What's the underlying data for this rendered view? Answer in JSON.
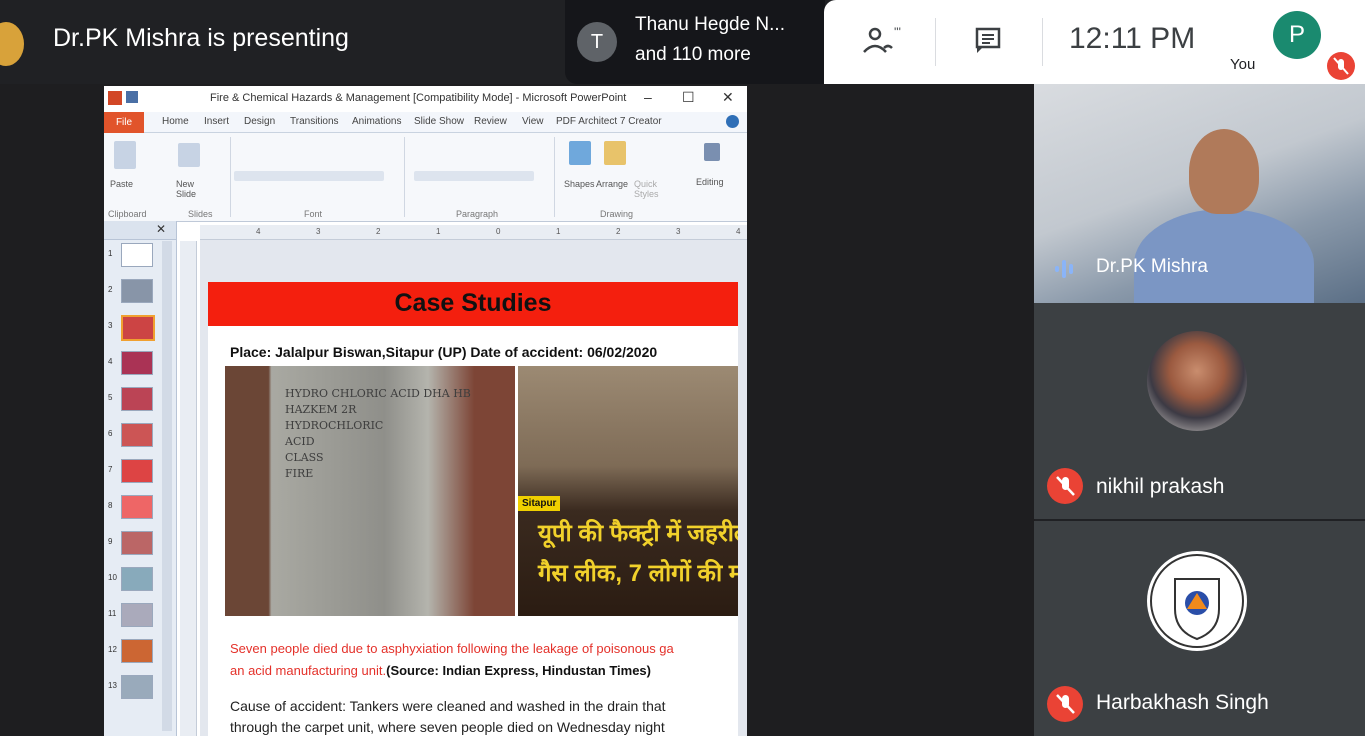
{
  "header": {
    "presenting_text": "Dr.PK Mishra is presenting",
    "participants_chip": {
      "avatar_letter": "T",
      "name": "Thanu Hegde N...",
      "more": "and 110 more"
    },
    "clock": "12:11 PM",
    "self": {
      "label": "You",
      "avatar_letter": "P"
    },
    "colors": {
      "mute": "#ea4335",
      "self_avatar": "#1a8a6f"
    }
  },
  "ppt": {
    "window_title": "Fire & Chemical Hazards & Management [Compatibility Mode] - Microsoft PowerPoint",
    "window_controls": [
      "–",
      "☐",
      "✕"
    ],
    "menu": [
      "File",
      "Home",
      "Insert",
      "Design",
      "Transitions",
      "Animations",
      "Slide Show",
      "Review",
      "View",
      "PDF Architect 7 Creator"
    ],
    "ribbon": {
      "paste": "Paste",
      "new_slide": "New Slide",
      "shapes": "Shapes",
      "arrange": "Arrange",
      "quick_styles": "Quick Styles",
      "editing": "Editing",
      "groups": [
        "Clipboard",
        "Slides",
        "Font",
        "Paragraph",
        "Drawing"
      ]
    },
    "thumbnails": [
      "1",
      "2",
      "3",
      "4",
      "5",
      "6",
      "7",
      "8",
      "9",
      "10",
      "11",
      "12",
      "13"
    ],
    "ruler_marks": [
      "4",
      "3",
      "2",
      "1",
      "0",
      "1",
      "2",
      "3",
      "4"
    ],
    "slide": {
      "title": "Case Studies",
      "place_line": "Place: Jalalpur Biswan,Sitapur (UP) Date of accident: 06/02/2020",
      "photo1_text": [
        "HYDRO CHLORIC ACID DHA HB",
        "HAZKEM 2R",
        "HYDROCHLORIC",
        "ACID",
        "CLASS",
        "FIRE"
      ],
      "photo2_tag": "Sitapur",
      "photo2_line1": "यूपी की फैक्ट्री में जहरील",
      "photo2_line2": "गैस लीक, 7 लोगों की मौ",
      "red_line1": "Seven people died due to asphyxiation following the leakage of poisonous ga",
      "red_line2_prefix": "an acid manufacturing unit.",
      "red_line2_source": "(Source: Indian Express, Hindustan Times)",
      "cause_line1": "Cause of accident: Tankers were cleaned and washed in the drain that",
      "cause_line2": "through the carpet unit, where seven people died on Wednesday night"
    }
  },
  "participants": [
    {
      "name": "Dr.PK Mishra",
      "state": "speaking"
    },
    {
      "name": "nikhil prakash",
      "state": "muted"
    },
    {
      "name": "Harbakhash Singh",
      "state": "muted",
      "logo_text": "CIVIL DEFENCE CORPS",
      "logo_sub": "BATALA"
    }
  ]
}
